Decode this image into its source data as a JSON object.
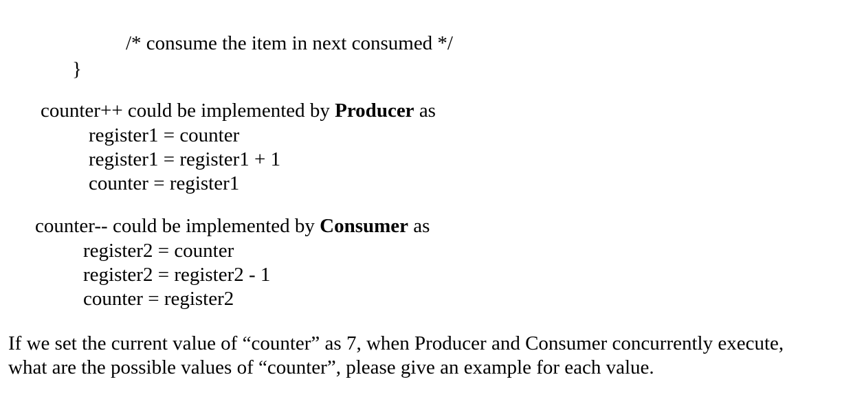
{
  "code_tail": {
    "comment": "/* consume the item in next consumed */",
    "closing_brace": "}"
  },
  "producer": {
    "intro_prefix": "counter++ could be implemented by ",
    "role": "Producer",
    "intro_suffix": " as",
    "lines": [
      "register1 = counter",
      "register1 = register1 + 1",
      "counter = register1"
    ]
  },
  "consumer": {
    "intro_prefix": "counter-- could be implemented by ",
    "role": "Consumer",
    "intro_suffix": " as",
    "lines": [
      "register2 = counter",
      "register2 = register2 - 1",
      "counter = register2"
    ]
  },
  "question": {
    "line1": "If we set the current value of “counter” as 7, when Producer and Consumer concurrently execute,",
    "line2": "what are the possible values of “counter”, please give an example for each value."
  }
}
